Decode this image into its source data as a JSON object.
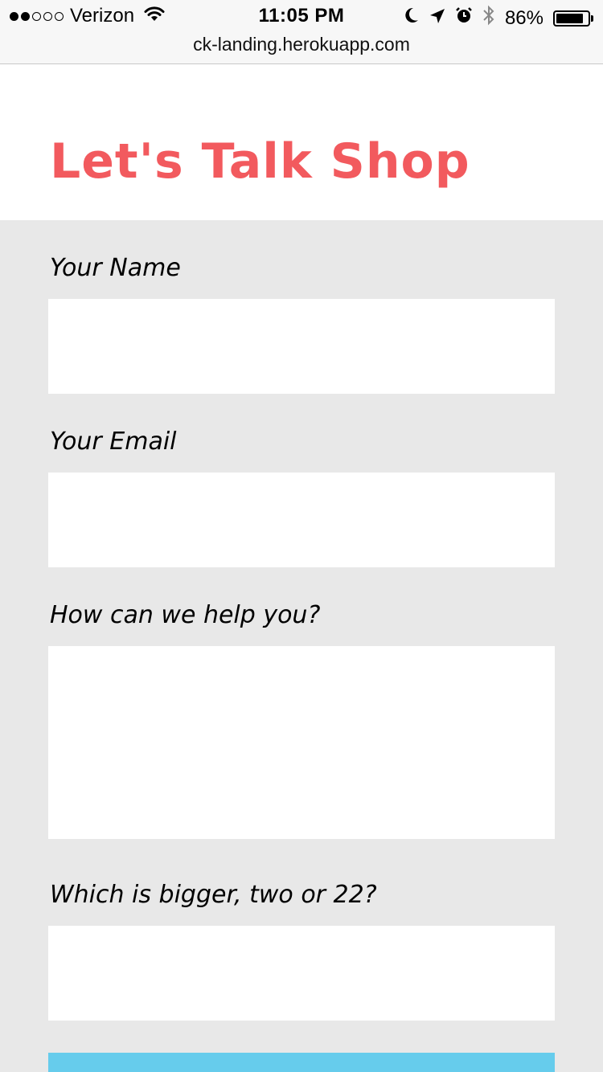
{
  "status_bar": {
    "signal_filled": 2,
    "signal_total": 5,
    "carrier": "Verizon",
    "time": "11:05 PM",
    "icons": [
      "wifi-icon",
      "moon-icon",
      "location-arrow-icon",
      "alarm-icon",
      "bluetooth-icon"
    ],
    "battery_percent": "86%",
    "battery_level": 0.86
  },
  "browser": {
    "url": "ck-landing.herokuapp.com"
  },
  "hero": {
    "title": "Let's Talk Shop",
    "title_color": "#f25a5e"
  },
  "form": {
    "name_label": "Your Name",
    "name_value": "",
    "email_label": "Your Email",
    "email_value": "",
    "help_label": "How can we help you?",
    "help_value": "",
    "captcha_label": "Which is bigger, two or 22?",
    "captcha_value": "",
    "submit_color": "#66ccec"
  }
}
